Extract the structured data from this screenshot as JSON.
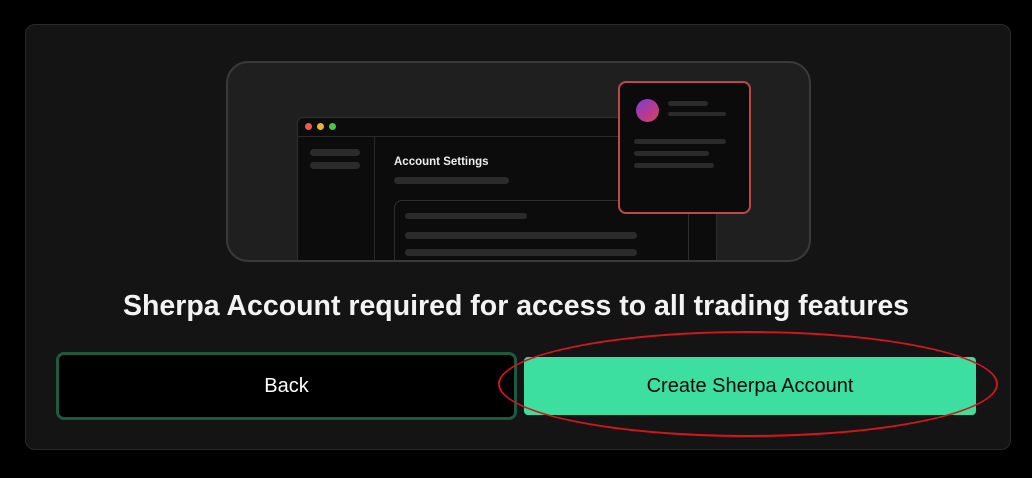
{
  "illustration": {
    "window_title": "Account Settings"
  },
  "dialog": {
    "message": "Sherpa Account required for access to all trading features",
    "back_label": "Back",
    "create_label": "Create Sherpa Account"
  },
  "colors": {
    "accent": "#3ddfa0",
    "back_border": "#1d5a3f",
    "popup_border": "#c04749",
    "annotation": "#d2161c"
  }
}
